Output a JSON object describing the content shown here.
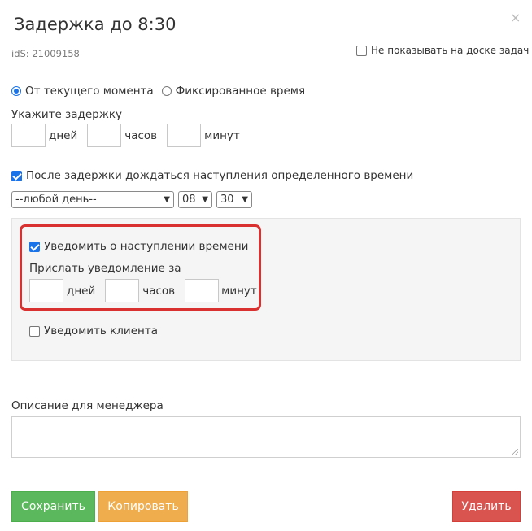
{
  "dialog": {
    "title": "Задержка до 8:30",
    "close_glyph": "×",
    "ids_label": "idS: 21009158",
    "hide_on_board_label": "Не показывать на доске задач",
    "hide_on_board_checked": false
  },
  "mode": {
    "from_now_label": "От текущего момента",
    "from_now_selected": true,
    "fixed_time_label": "Фиксированное время",
    "fixed_time_selected": false
  },
  "delay": {
    "heading": "Укажите задержку",
    "days_value": "",
    "days_label": "дней",
    "hours_value": "",
    "hours_label": "часов",
    "minutes_value": "",
    "minutes_label": "минут"
  },
  "wait_time": {
    "checkbox_label": "После задержки дождаться наступления определенного времени",
    "checked": true,
    "day_select_value": "--любой день--",
    "hour_select_value": "08",
    "minute_select_value": "30"
  },
  "notify": {
    "checkbox_label": "Уведомить о наступлении времени",
    "checked": true,
    "send_before_heading": "Прислать уведомление за",
    "days_value": "",
    "days_label": "дней",
    "hours_value": "",
    "hours_label": "часов",
    "minutes_value": "",
    "minutes_label": "минут",
    "notify_client_label": "Уведомить клиента",
    "notify_client_checked": false
  },
  "manager_note": {
    "heading": "Описание для менеджера",
    "value": ""
  },
  "buttons": {
    "save": "Сохранить",
    "copy": "Копировать",
    "delete": "Удалить"
  },
  "colors": {
    "save": "#5cb85c",
    "copy": "#f0ad4e",
    "delete": "#d9534f",
    "highlight": "#d93030",
    "accent": "#1a73e8"
  }
}
